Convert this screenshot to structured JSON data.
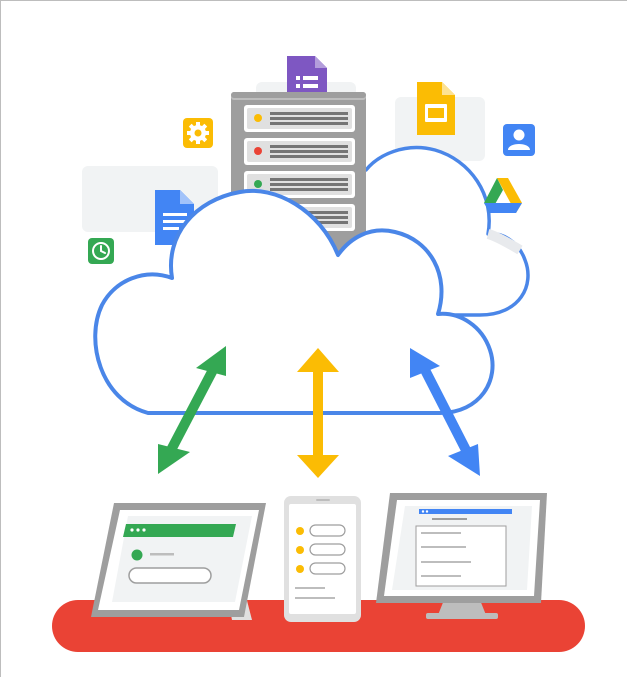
{
  "colors": {
    "cloud_outline": "#4a86e8",
    "arrow_left": "#34a853",
    "arrow_center": "#fbbc04",
    "arrow_right": "#4285f4",
    "server": "#9e9e9e",
    "server_dark": "#757575",
    "table": "#ea4335",
    "device_gray": "#9e9e9e",
    "screen_bg": "#f1f3f4",
    "green_ui": "#34a853",
    "blue_ui": "#4285f4",
    "yellow_ui": "#fbbc04",
    "purple_forms": "#7e57c2"
  },
  "icons": [
    "settings-icon",
    "clock-icon",
    "google-forms-icon",
    "google-docs-icon",
    "google-slides-icon",
    "contacts-icon",
    "google-drive-icon"
  ],
  "devices": [
    "tablet",
    "phone",
    "desktop-monitor"
  ]
}
